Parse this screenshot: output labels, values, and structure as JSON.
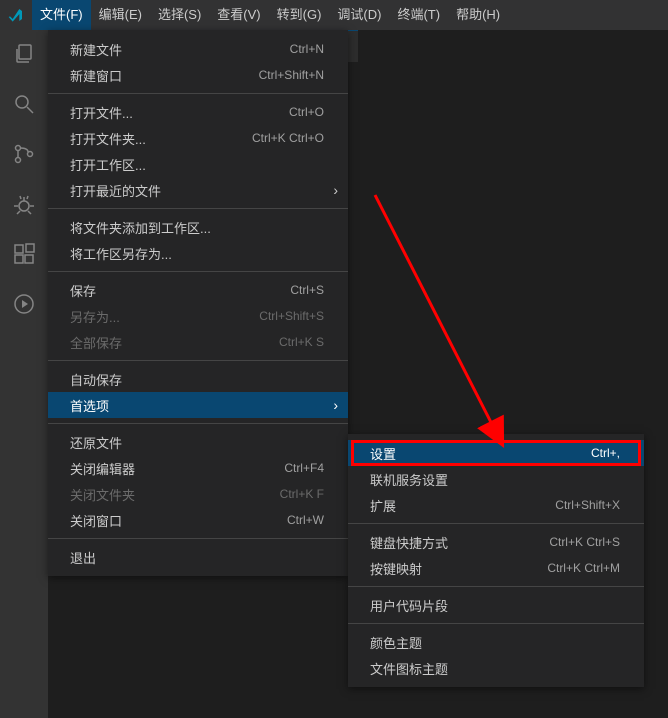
{
  "menu": {
    "items": [
      {
        "label": "文件(F)"
      },
      {
        "label": "编辑(E)"
      },
      {
        "label": "选择(S)"
      },
      {
        "label": "查看(V)"
      },
      {
        "label": "转到(G)"
      },
      {
        "label": "调试(D)"
      },
      {
        "label": "终端(T)"
      },
      {
        "label": "帮助(H)"
      }
    ]
  },
  "fileMenu": {
    "groups": [
      [
        {
          "label": "新建文件",
          "shortcut": "Ctrl+N"
        },
        {
          "label": "新建窗口",
          "shortcut": "Ctrl+Shift+N"
        }
      ],
      [
        {
          "label": "打开文件...",
          "shortcut": "Ctrl+O"
        },
        {
          "label": "打开文件夹...",
          "shortcut": "Ctrl+K Ctrl+O"
        },
        {
          "label": "打开工作区..."
        },
        {
          "label": "打开最近的文件",
          "submenu": true
        }
      ],
      [
        {
          "label": "将文件夹添加到工作区..."
        },
        {
          "label": "将工作区另存为..."
        }
      ],
      [
        {
          "label": "保存",
          "shortcut": "Ctrl+S"
        },
        {
          "label": "另存为...",
          "shortcut": "Ctrl+Shift+S",
          "disabled": true
        },
        {
          "label": "全部保存",
          "shortcut": "Ctrl+K S",
          "disabled": true
        }
      ],
      [
        {
          "label": "自动保存"
        },
        {
          "label": "首选项",
          "submenu": true,
          "highlight": true
        }
      ],
      [
        {
          "label": "还原文件"
        },
        {
          "label": "关闭编辑器",
          "shortcut": "Ctrl+F4"
        },
        {
          "label": "关闭文件夹",
          "shortcut": "Ctrl+K F",
          "disabled": true
        },
        {
          "label": "关闭窗口",
          "shortcut": "Ctrl+W"
        }
      ],
      [
        {
          "label": "退出"
        }
      ]
    ]
  },
  "prefMenu": {
    "groups": [
      [
        {
          "label": "设置",
          "shortcut": "Ctrl+,",
          "highlight": true
        },
        {
          "label": "联机服务设置"
        },
        {
          "label": "扩展",
          "shortcut": "Ctrl+Shift+X"
        }
      ],
      [
        {
          "label": "键盘快捷方式",
          "shortcut": "Ctrl+K Ctrl+S"
        },
        {
          "label": "按键映射",
          "shortcut": "Ctrl+K Ctrl+M"
        }
      ],
      [
        {
          "label": "用户代码片段"
        }
      ],
      [
        {
          "label": "颜色主题"
        },
        {
          "label": "文件图标主题"
        }
      ]
    ]
  }
}
